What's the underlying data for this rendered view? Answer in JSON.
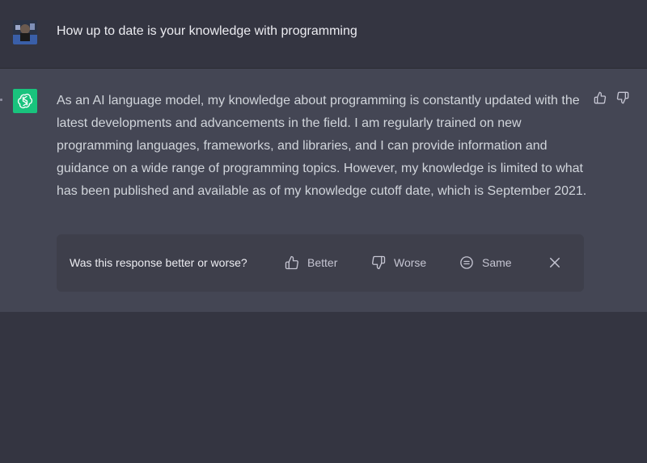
{
  "conversation": {
    "user_message": "How up to date is your knowledge with programming",
    "assistant_message": "As an AI language model, my knowledge about programming is constantly updated with the latest developments and advancements in the field. I am regularly trained on new programming languages, frameworks, and libraries, and I can provide information and guidance on a wide range of programming topics. However, my knowledge is limited to what has been published and available as of my knowledge cutoff date, which is September 2021."
  },
  "feedback": {
    "question": "Was this response better or worse?",
    "better_label": "Better",
    "worse_label": "Worse",
    "same_label": "Same"
  },
  "icons": {
    "assistant_avatar": "openai-logo-icon",
    "thumbs_up": "thumbs-up-icon",
    "thumbs_down": "thumbs-down-icon",
    "same": "equal-circle-icon",
    "close": "close-icon"
  },
  "colors": {
    "background": "#343541",
    "assistant_row": "#444654",
    "feedback_panel": "#3e3f4b",
    "assistant_avatar": "#19c37d"
  }
}
